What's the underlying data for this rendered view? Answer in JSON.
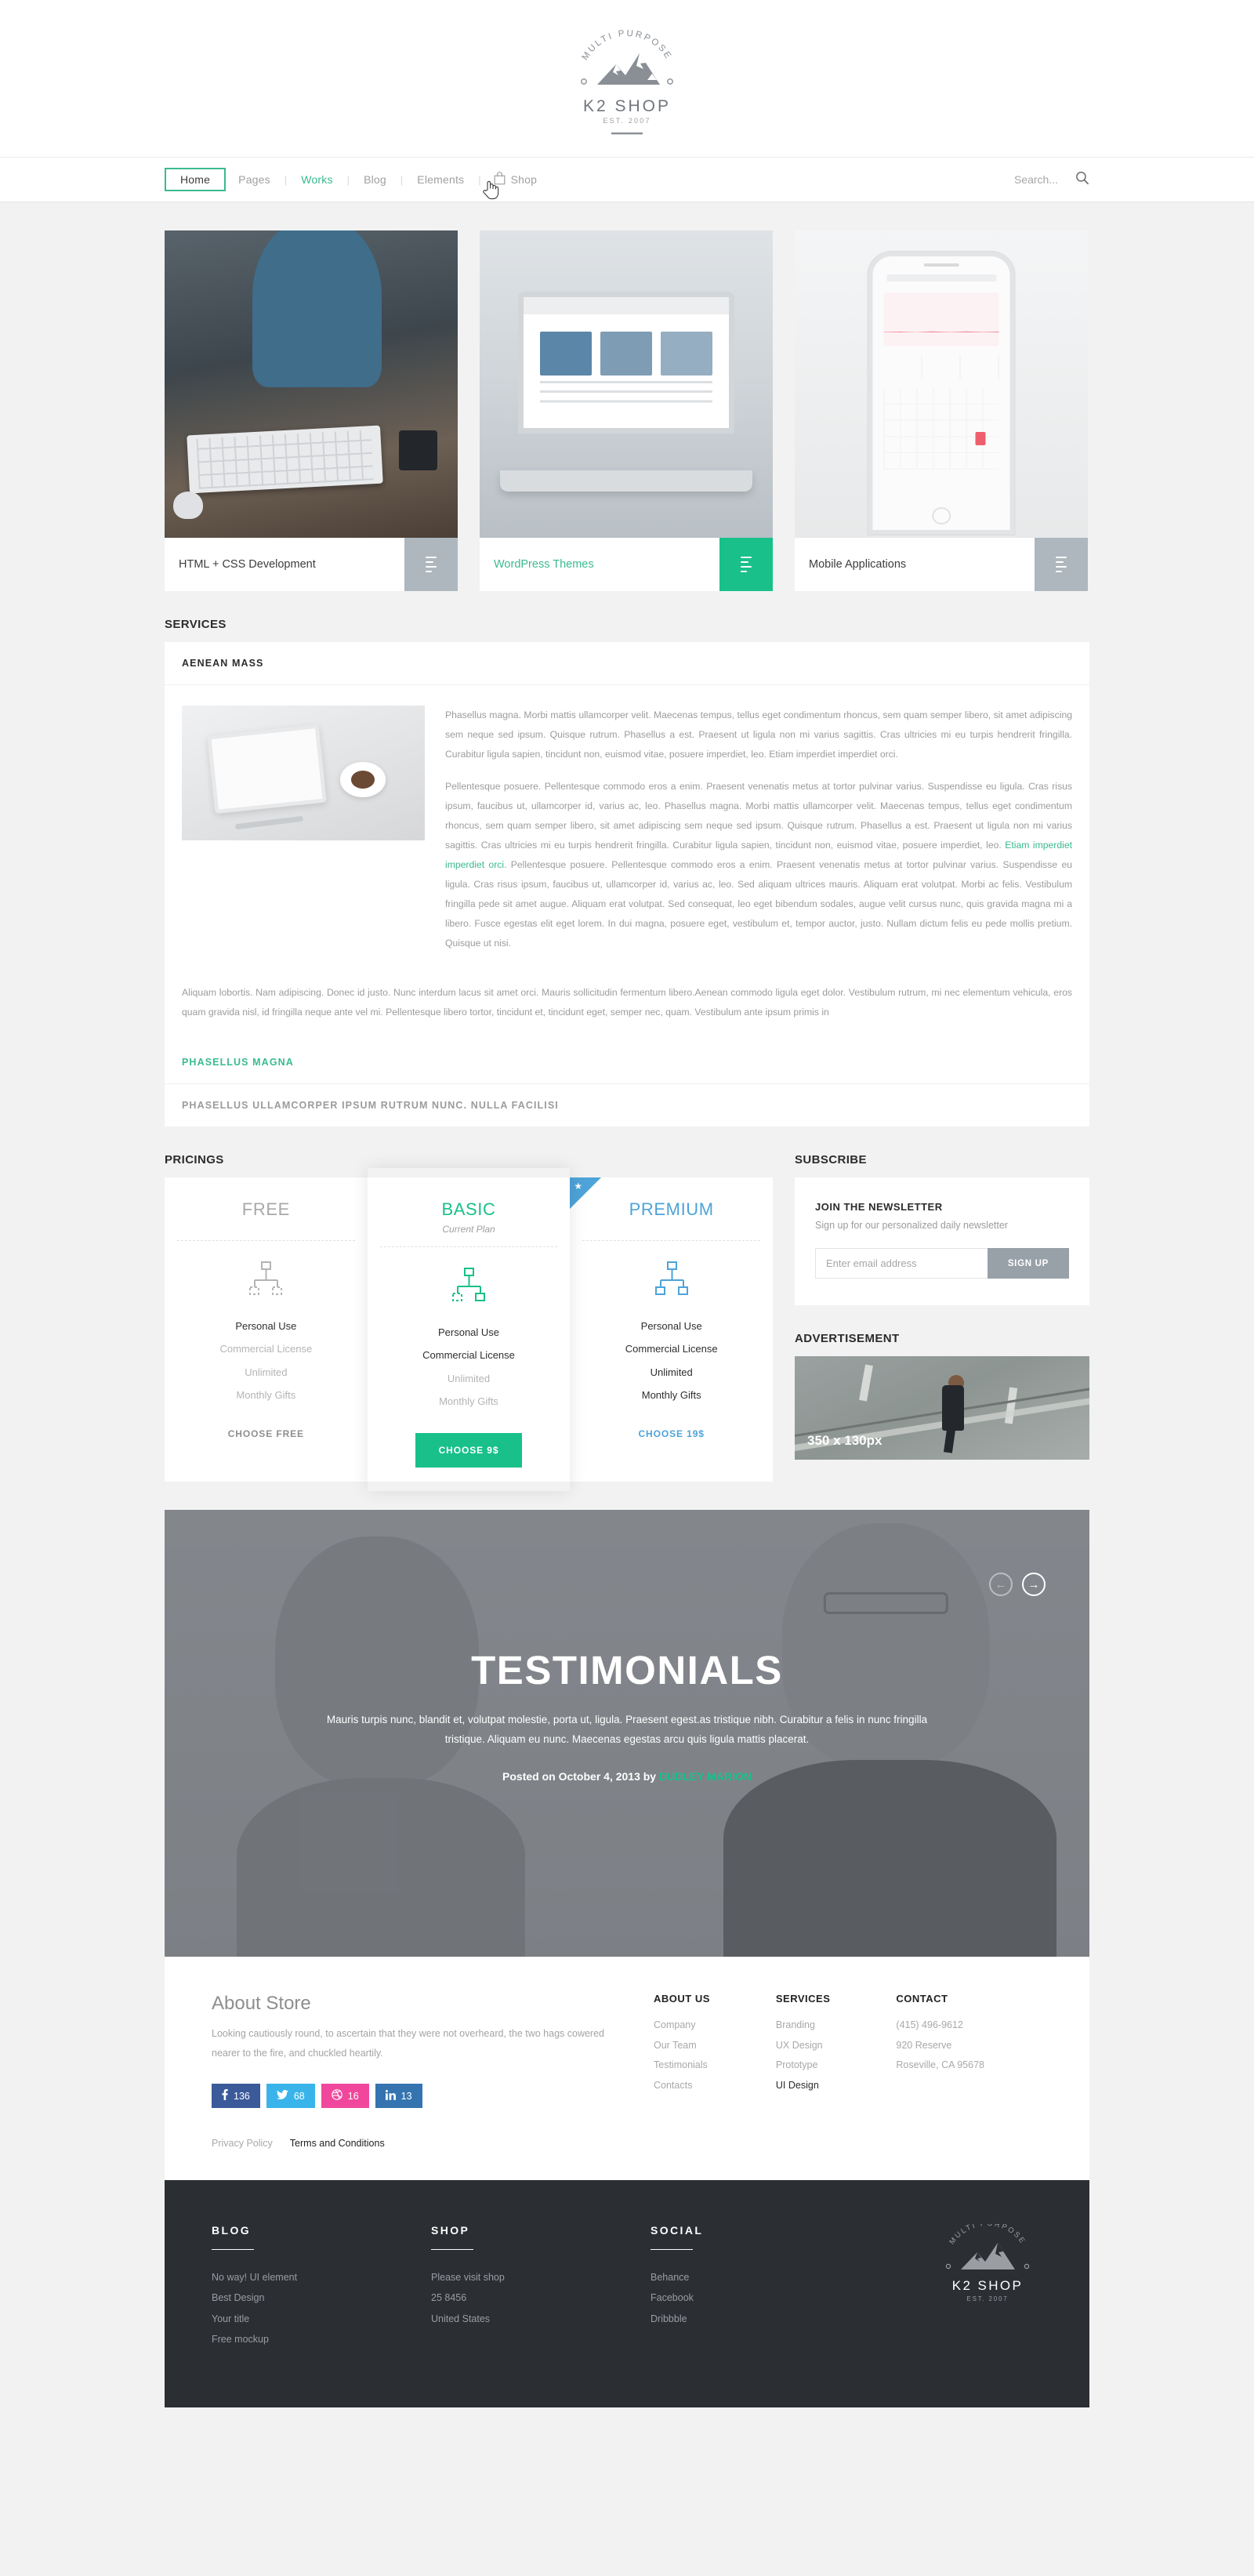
{
  "brand": {
    "tagline": "MULTI PURPOSE",
    "name": "K2 SHOP",
    "est": "EST. 2007",
    "accent": "#19c08a",
    "blue": "#4ea3d8"
  },
  "nav": {
    "items": [
      {
        "label": "Home",
        "state": "active"
      },
      {
        "label": "Pages",
        "state": "normal"
      },
      {
        "label": "Works",
        "state": "hovered"
      },
      {
        "label": "Blog",
        "state": "normal"
      },
      {
        "label": "Elements",
        "state": "normal"
      }
    ],
    "shop_label": "Shop",
    "separator": "|"
  },
  "search": {
    "placeholder": "Search...",
    "value": ""
  },
  "portfolio": {
    "cards": [
      {
        "title": "HTML + CSS Development",
        "highlight": false
      },
      {
        "title": "WordPress Themes",
        "highlight": true
      },
      {
        "title": "Mobile Applications",
        "highlight": false
      }
    ]
  },
  "services": {
    "heading": "SERVICES",
    "items": [
      {
        "label": "AENEAN MASS",
        "state": "open"
      },
      {
        "label": "PHASELLUS MAGNA",
        "state": "teal"
      },
      {
        "label": "PHASELLUS ULLAMCORPER IPSUM RUTRUM NUNC. NULLA FACILISI",
        "state": "muted"
      }
    ],
    "paragraph1": "Phasellus magna. Morbi mattis ullamcorper velit. Maecenas tempus, tellus eget condimentum rhoncus, sem quam semper libero, sit amet adipiscing sem neque sed ipsum. Quisque rutrum. Phasellus a est. Praesent ut ligula non mi varius sagittis. Cras ultricies mi eu turpis hendrerit fringilla. Curabitur ligula sapien, tincidunt non, euismod vitae, posuere imperdiet, leo. Etiam imperdiet imperdiet orci.",
    "paragraph2_a": "Pellentesque posuere. Pellentesque commodo eros a enim. Praesent venenatis metus at tortor pulvinar varius. Suspendisse eu ligula. Cras risus ipsum, faucibus ut, ullamcorper id, varius ac, leo. Phasellus magna. Morbi mattis ullamcorper velit. Maecenas tempus, tellus eget condimentum rhoncus, sem quam semper libero, sit amet adipiscing sem neque sed ipsum. Quisque rutrum. Phasellus a est. Praesent ut ligula non mi varius sagittis. Cras ultricies mi eu turpis hendrerit fringilla. Curabitur ligula sapien, tincidunt non, euismod vitae, posuere imperdiet, leo. ",
    "paragraph2_link": "Etiam imperdiet imperdiet orci",
    "paragraph2_b": ". Pellentesque posuere. Pellentesque commodo eros a enim. Praesent venenatis metus at tortor pulvinar varius. Suspendisse eu ligula. Cras risus ipsum, faucibus ut, ullamcorper id, varius ac, leo. Sed aliquam ultrices mauris. Aliquam erat volutpat. Morbi ac felis. Vestibulum fringilla pede sit amet augue. Aliquam erat volutpat. Sed consequat, leo eget bibendum sodales, augue velit cursus nunc, quis gravida magna mi a libero. Fusce egestas elit eget lorem. In dui magna, posuere eget, vestibulum et, tempor auctor, justo. Nullam dictum felis eu pede mollis pretium. Quisque ut nisi.",
    "paragraph3": "Aliquam lobortis. Nam adipiscing. Donec id justo. Nunc interdum lacus sit amet orci. Mauris sollicitudin fermentum libero.Aenean commodo ligula eget dolor. Vestibulum rutrum, mi nec elementum vehicula, eros quam gravida nisl, id fringilla neque ante vel mi. Pellentesque libero tortor, tincidunt et, tincidunt eget, semper nec, quam. Vestibulum ante ipsum primis in"
  },
  "pricing": {
    "heading": "PRICINGS",
    "plans": [
      {
        "name": "FREE",
        "subtitle": "",
        "style": "gray",
        "features": [
          {
            "label": "Personal Use",
            "active": true
          },
          {
            "label": "Commercial License",
            "active": false
          },
          {
            "label": "Unlimited",
            "active": false
          },
          {
            "label": "Monthly Gifts",
            "active": false
          }
        ],
        "cta": "CHOOSE FREE",
        "cta_style": "flat-gray",
        "featured": false
      },
      {
        "name": "BASIC",
        "subtitle": "Current Plan",
        "style": "teal",
        "features": [
          {
            "label": "Personal Use",
            "active": true
          },
          {
            "label": "Commercial License",
            "active": true
          },
          {
            "label": "Unlimited",
            "active": false
          },
          {
            "label": "Monthly Gifts",
            "active": false
          }
        ],
        "cta": "CHOOSE 9$",
        "cta_style": "solid-teal",
        "featured": true
      },
      {
        "name": "PREMIUM",
        "subtitle": "",
        "style": "blue",
        "features": [
          {
            "label": "Personal Use",
            "active": true
          },
          {
            "label": "Commercial License",
            "active": true
          },
          {
            "label": "Unlimited",
            "active": true
          },
          {
            "label": "Monthly Gifts",
            "active": true
          }
        ],
        "cta": "CHOOSE 19$",
        "cta_style": "flat-blue",
        "featured": false,
        "ribbon": true
      }
    ]
  },
  "subscribe": {
    "heading": "SUBSCRIBE",
    "title": "JOIN THE NEWSLETTER",
    "description": "Sign up for our personalized daily newsletter",
    "input_placeholder": "Enter email address",
    "input_value": "",
    "button": "SIGN UP"
  },
  "advertisement": {
    "heading": "ADVERTISEMENT",
    "placeholder_label": "350 x 130px"
  },
  "testimonials": {
    "title": "TESTIMONIALS",
    "quote": "Mauris turpis nunc, blandit et, volutpat molestie, porta ut, ligula. Praesent egest.as tristique nibh. Curabitur a felis in nunc fringilla tristique. Aliquam eu nunc. Maecenas egestas arcu quis ligula mattis placerat.",
    "posted_prefix": "Posted on October 4, 2013 by ",
    "author": "DUDLEY MARION",
    "prev_label": "←",
    "next_label": "→"
  },
  "about": {
    "title": "About Store",
    "text": "Looking cautiously round, to ascertain that they were not overheard, the two hags cowered nearer to the fire, and chuckled heartily.",
    "socials": [
      {
        "network": "facebook",
        "count": "136"
      },
      {
        "network": "twitter",
        "count": "68"
      },
      {
        "network": "dribbble",
        "count": "16"
      },
      {
        "network": "linkedin",
        "count": "13"
      }
    ],
    "columns": [
      {
        "heading": "ABOUT US",
        "links": [
          {
            "label": "Company",
            "active": false
          },
          {
            "label": "Our Team",
            "active": false
          },
          {
            "label": "Testimonials",
            "active": false
          },
          {
            "label": "Contacts",
            "active": false
          }
        ]
      },
      {
        "heading": "SERVICES",
        "links": [
          {
            "label": "Branding",
            "active": false
          },
          {
            "label": "UX Design",
            "active": false
          },
          {
            "label": "Prototype",
            "active": false
          },
          {
            "label": "UI Design",
            "active": true
          }
        ]
      },
      {
        "heading": "CONTACT",
        "links": [
          {
            "label": "(415) 496-9612",
            "active": false
          },
          {
            "label": "920 Reserve",
            "active": false
          },
          {
            "label": "Roseville, CA 95678",
            "active": false
          }
        ]
      }
    ],
    "legal": [
      {
        "label": "Privacy Policy",
        "active": false
      },
      {
        "label": "Terms and Conditions",
        "active": true
      }
    ]
  },
  "footer": {
    "columns": [
      {
        "heading": "BLOG",
        "links": [
          "No way! UI element",
          "Best Design",
          "Your title",
          "Free mockup"
        ]
      },
      {
        "heading": "SHOP",
        "links": [
          "Please visit shop",
          "25 8456",
          "United States"
        ]
      },
      {
        "heading": "SOCIAL",
        "links": [
          "Behance",
          "Facebook",
          "Dribbble"
        ]
      }
    ]
  }
}
